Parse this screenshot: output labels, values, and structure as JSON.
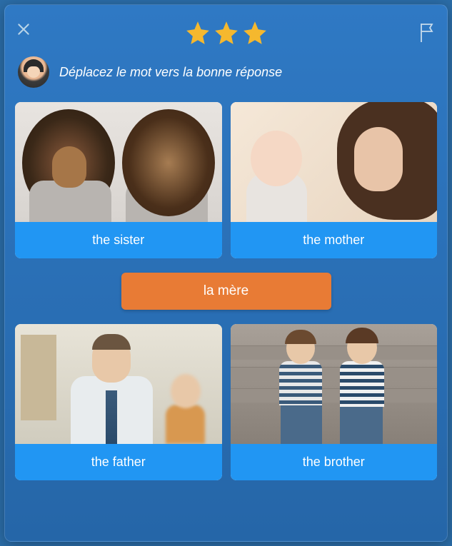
{
  "stars": 3,
  "instruction": "Déplacez le mot vers la bonne réponse",
  "draggable_word": "la mère",
  "cards": [
    {
      "label": "the sister"
    },
    {
      "label": "the mother"
    },
    {
      "label": "the father"
    },
    {
      "label": "the brother"
    }
  ]
}
